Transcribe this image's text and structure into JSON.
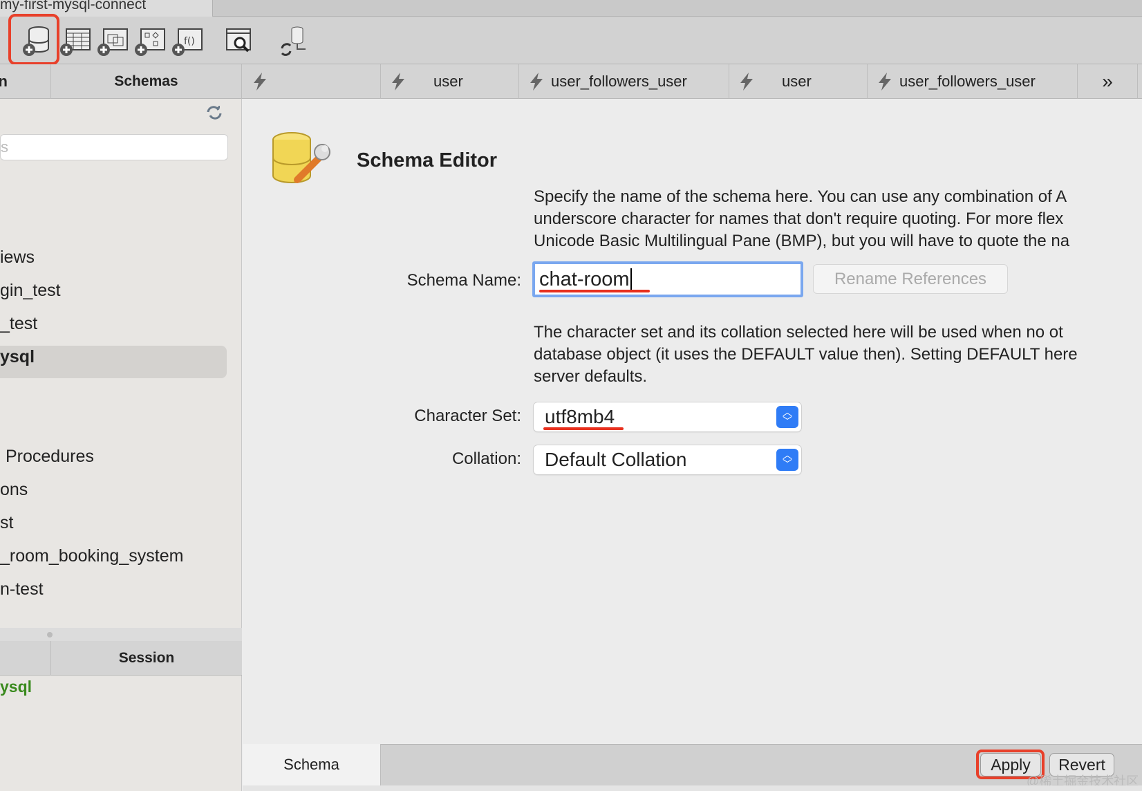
{
  "window": {
    "title_tab": "my-first-mysql-connect"
  },
  "toolbar": {
    "icons": [
      "create-schema-icon",
      "create-table-icon",
      "create-view-icon",
      "create-procedure-icon",
      "create-function-icon",
      "search-table-data-icon",
      "reconnect-icon"
    ]
  },
  "sidebar": {
    "tabs": [
      "n",
      "Schemas"
    ],
    "search_placeholder": "s",
    "items": [
      "iews",
      "gin_test",
      "_test",
      "ysql",
      "Procedures",
      "ons",
      "st",
      "_room_booking_system",
      "n-test"
    ],
    "session_tabs": [
      "",
      "Session"
    ],
    "session_value": "ysql"
  },
  "tabs": [
    "",
    "user",
    "user_followers_user",
    "user",
    "user_followers_user"
  ],
  "editor": {
    "title": "Schema Editor",
    "desc1": [
      "Specify the name of the schema here. You can use any combination of A",
      "underscore character for names that don't require quoting. For more flex",
      "Unicode Basic Multilingual Pane (BMP), but you will have to quote the na"
    ],
    "name_label": "Schema Name:",
    "name_value": "chat-room",
    "rename_label": "Rename References",
    "desc2": [
      "The character set and its collation selected here will be used when no ot",
      "database object (it uses the DEFAULT value then). Setting DEFAULT here",
      "server defaults."
    ],
    "charset_label": "Character Set:",
    "charset_value": "utf8mb4",
    "collation_label": "Collation:",
    "collation_value": "Default Collation"
  },
  "bottom": {
    "tab": "Schema",
    "apply": "Apply",
    "revert": "Revert"
  },
  "watermark": "@稀土掘金技术社区",
  "colors": {
    "highlight": "#e8402a",
    "accent": "#2f7cf6",
    "session_green": "#3a8a1e"
  }
}
